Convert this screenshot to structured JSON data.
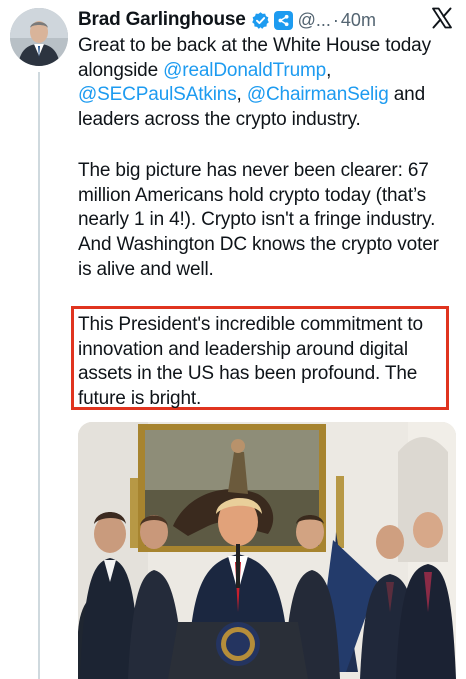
{
  "tweet": {
    "author_name": "Brad Garlinghouse",
    "handle": "@...",
    "separator": "·",
    "time": "40m",
    "mentions": [
      "@realDonaldTrump",
      "@SECPaulSAtkins",
      "@ChairmanSelig"
    ],
    "paragraph1": {
      "a": "Great to be back at the White House today alongside ",
      "b": ", ",
      "c": ", ",
      "d": " and leaders across the crypto industry."
    },
    "paragraph2": "The big picture has never been clearer: 67 million Americans hold crypto today (that’s nearly 1 in 4!). Crypto isn't a fringe industry. And Washington DC knows the crypto voter is alive and well.",
    "paragraph3": "This President's incredible commitment to innovation and leadership around digital assets in the US has been profound. The future is bright."
  },
  "icons": {
    "verified": "verified-badge-icon",
    "affiliate": "ripple-affiliate-icon",
    "x_logo": "x-logo-icon"
  },
  "colors": {
    "mention": "#1d9bf0",
    "verified": "#1d9bf0",
    "highlight_border": "#e0341f",
    "text": "#0f1419",
    "secondary": "#536471"
  }
}
